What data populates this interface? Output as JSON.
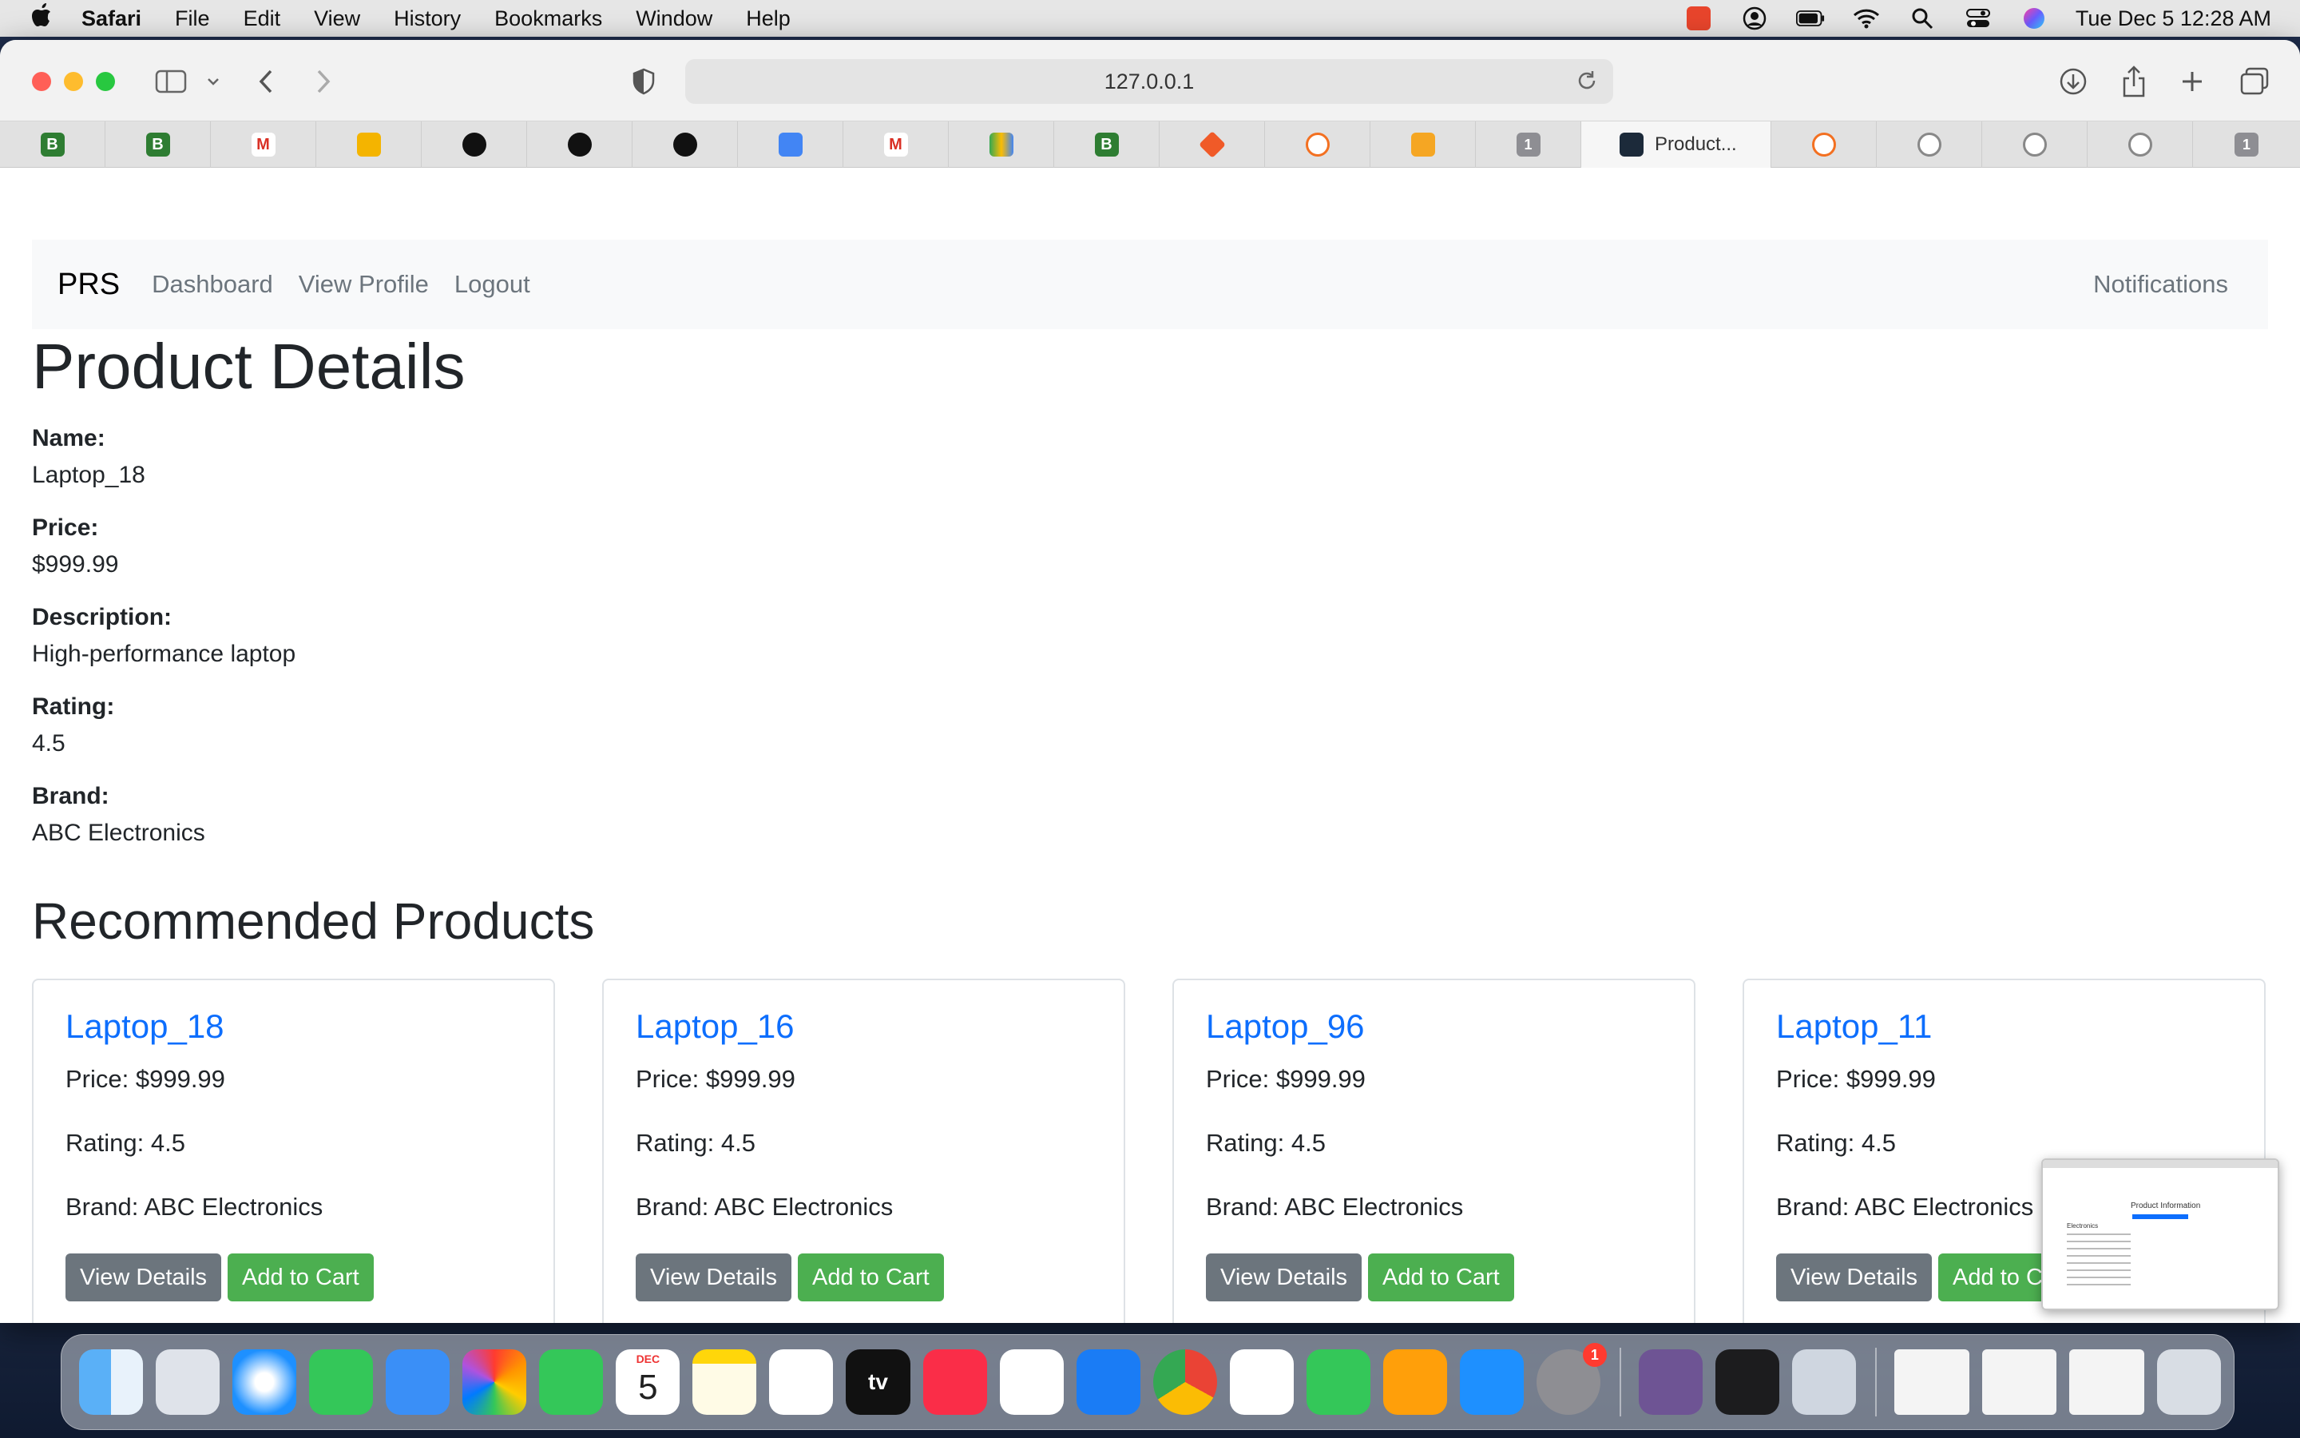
{
  "menubar": {
    "app_name": "Safari",
    "items": [
      "File",
      "Edit",
      "View",
      "History",
      "Bookmarks",
      "Window",
      "Help"
    ],
    "clock": "Tue Dec 5  12:28 AM"
  },
  "browser": {
    "url": "127.0.0.1",
    "active_tab_title": "Product...",
    "tab_badge_1": "1",
    "tab_badge_2": "1"
  },
  "navbar": {
    "brand": "PRS",
    "links": [
      "Dashboard",
      "View Profile",
      "Logout"
    ],
    "right_link": "Notifications"
  },
  "product": {
    "page_title": "Product Details",
    "fields": [
      {
        "label": "Name:",
        "value": "Laptop_18"
      },
      {
        "label": "Price:",
        "value": "$999.99"
      },
      {
        "label": "Description:",
        "value": "High-performance laptop"
      },
      {
        "label": "Rating:",
        "value": "4.5"
      },
      {
        "label": "Brand:",
        "value": "ABC Electronics"
      }
    ]
  },
  "recommended": {
    "title": "Recommended Products",
    "view_details_label": "View Details",
    "add_to_cart_label": "Add to Cart",
    "cards": [
      {
        "name": "Laptop_18",
        "price": "Price: $999.99",
        "rating": "Rating: 4.5",
        "brand": "Brand: ABC Electronics"
      },
      {
        "name": "Laptop_16",
        "price": "Price: $999.99",
        "rating": "Rating: 4.5",
        "brand": "Brand: ABC Electronics"
      },
      {
        "name": "Laptop_96",
        "price": "Price: $999.99",
        "rating": "Rating: 4.5",
        "brand": "Brand: ABC Electronics"
      },
      {
        "name": "Laptop_11",
        "price": "Price: $999.99",
        "rating": "Rating: 4.5",
        "brand": "Brand: ABC Electronics"
      }
    ]
  },
  "preview": {
    "title": "Product Information",
    "subtitle": "Electronics"
  },
  "dock": {
    "calendar_month": "DEC",
    "calendar_day": "5",
    "settings_badge": "1",
    "appletv_label": "tv"
  },
  "colors": {
    "link_blue": "#0d6efd",
    "btn_secondary": "#6c757d",
    "btn_success": "#4caf50",
    "navbar_bg": "#f8f9fa"
  }
}
